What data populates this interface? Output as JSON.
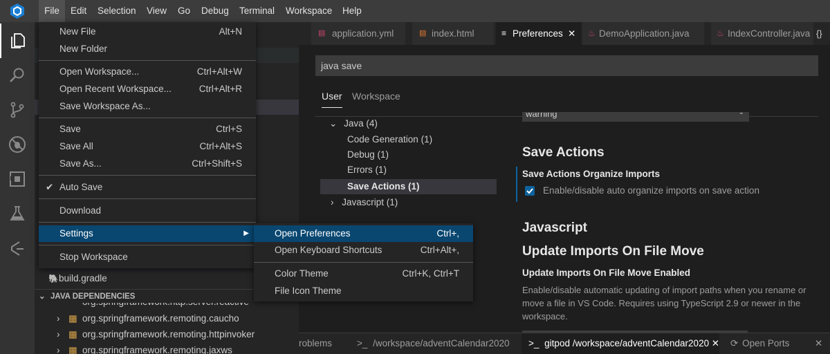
{
  "menubar": {
    "items": [
      "File",
      "Edit",
      "Selection",
      "View",
      "Go",
      "Debug",
      "Terminal",
      "Workspace",
      "Help"
    ]
  },
  "activity_icons": [
    "explorer-icon",
    "search-icon",
    "source-control-icon",
    "debug-icon",
    "extensions-icon",
    "test-icon",
    "gitpod-icon"
  ],
  "file_menu": {
    "new_file": "New File",
    "new_file_sc": "Alt+N",
    "new_folder": "New Folder",
    "open_workspace": "Open Workspace...",
    "open_workspace_sc": "Ctrl+Alt+W",
    "open_recent": "Open Recent Workspace...",
    "open_recent_sc": "Ctrl+Alt+R",
    "save_ws_as": "Save Workspace As...",
    "save": "Save",
    "save_sc": "Ctrl+S",
    "save_all": "Save All",
    "save_all_sc": "Ctrl+Alt+S",
    "save_as": "Save As...",
    "save_as_sc": "Ctrl+Shift+S",
    "auto_save": "Auto Save",
    "download": "Download",
    "settings": "Settings",
    "stop_workspace": "Stop Workspace"
  },
  "settings_submenu": {
    "open_prefs": "Open Preferences",
    "open_prefs_sc": "Ctrl+,",
    "keyboard": "Open Keyboard Shortcuts",
    "keyboard_sc": "Ctrl+Alt+,",
    "color_theme": "Color Theme",
    "color_theme_sc": "Ctrl+K, Ctrl+T",
    "file_icon_theme": "File Icon Theme"
  },
  "sidebar": {
    "build_gradle": "build.gradle",
    "java_deps": "JAVA DEPENDENCIES",
    "dep1": "org.springframework.http.server.reactive",
    "dep2": "org.springframework.remoting.caucho",
    "dep3": "org.springframework.remoting.httpinvoker",
    "dep4": "org.springframework.remoting.jaxws"
  },
  "tabs": {
    "t1": "application.yml",
    "t2": "index.html",
    "t3": "Preferences",
    "t4": "DemoApplication.java",
    "t5": "IndexController.java",
    "braces": "{}"
  },
  "prefs": {
    "search_value": "java save",
    "scope_user": "User",
    "scope_workspace": "Workspace",
    "toc_java": "Java (4)",
    "toc_codegen": "Code Generation (1)",
    "toc_debug": "Debug (1)",
    "toc_errors": "Errors (1)",
    "toc_save_actions": "Save Actions (1)",
    "toc_javascript": "Javascript (1)",
    "dropdown_value": "warning",
    "h_save_actions": "Save Actions",
    "s_organize_title": "Save Actions Organize Imports",
    "s_organize_desc": "Enable/disable auto organize imports on save action",
    "s_organize_checked": true,
    "h_javascript": "Javascript",
    "h_update_imports": "Update Imports On File Move",
    "s_update_title": "Update Imports On File Move Enabled",
    "s_update_desc": "Enable/disable automatic updating of import paths when you rename or move a file in VS Code. Requires using TypeScript 2.9 or newer in the workspace."
  },
  "panel": {
    "problems": "roblems",
    "term1": "/workspace/adventCalendar2020",
    "term2": "gitpod /workspace/adventCalendar2020",
    "ports": "Open Ports"
  },
  "colors": {
    "accent": "#094771",
    "checkbox": "#0e639c",
    "file_icon": "#e37933",
    "java_icon": "#c8456a",
    "gradle_icon": "#4a8bc2"
  }
}
